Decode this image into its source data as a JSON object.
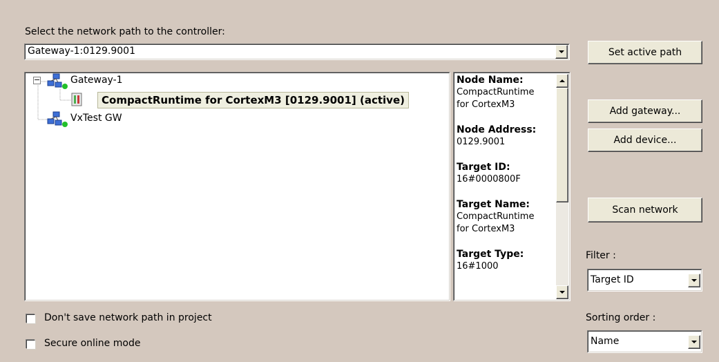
{
  "path_label": "Select the network path to the controller:",
  "path_combo": {
    "value": "Gateway-1:0129.9001"
  },
  "buttons": {
    "set_active_path": "Set active path",
    "add_gateway": "Add gateway...",
    "add_device": "Add device...",
    "scan_network": "Scan network"
  },
  "tree": {
    "gateway1": {
      "label": "Gateway-1",
      "expander": "−"
    },
    "device": {
      "label": "CompactRuntime for CortexM3 [0129.9001] (active)"
    },
    "gateway2": {
      "label": "VxTest GW"
    }
  },
  "info": {
    "node_name_label": "Node Name:",
    "node_name_line1": "CompactRuntime",
    "node_name_line2": "for CortexM3",
    "node_address_label": "Node Address:",
    "node_address_value": "0129.9001",
    "target_id_label": "Target ID:",
    "target_id_value": "16#0000800F",
    "target_name_label": "Target Name:",
    "target_name_line1": "CompactRuntime",
    "target_name_line2": "for CortexM3",
    "target_type_label": "Target Type:",
    "target_type_value": "16#1000"
  },
  "filter": {
    "label": "Filter :",
    "value": "Target ID"
  },
  "sorting": {
    "label": "Sorting order :",
    "value": "Name"
  },
  "options": {
    "dont_save_label": "Don't save network path in project",
    "dont_save_checked": false,
    "secure_online_label": "Secure online mode",
    "secure_online_checked": false
  },
  "colors": {
    "status_online": "#22c02a",
    "background": "#d4c8be"
  },
  "icons": {
    "gateway": "network-gateway-icon",
    "device": "plc-device-icon",
    "status": "green-dot-status-icon"
  }
}
